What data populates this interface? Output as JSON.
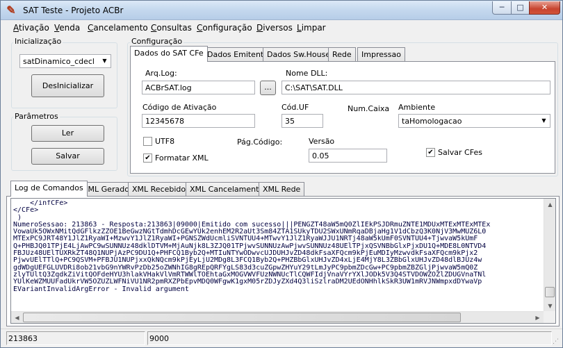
{
  "window": {
    "title": "SAT Teste - Projeto ACBr",
    "minimize": "─",
    "maximize": "□",
    "close": "✕",
    "icon": "acbr-app-icon"
  },
  "menu": [
    "Ativação",
    "Venda",
    "Cancelamento",
    "Consultas",
    "Configuração",
    "Diversos",
    "Limpar"
  ],
  "left": {
    "inicializacao": {
      "title": "Inicialização",
      "model": "satDinamico_cdecl",
      "button": "DesInicializar"
    },
    "parametros": {
      "title": "Parâmetros",
      "ler": "Ler",
      "salvar": "Salvar"
    }
  },
  "config": {
    "title": "Configuração",
    "tabs": [
      "Dados do SAT CFe",
      "Dados Emitente",
      "Dados Sw.House",
      "Rede",
      "Impressao"
    ],
    "arq_log": {
      "label": "Arq.Log:",
      "value": "ACBrSAT.log",
      "browse": "..."
    },
    "nome_dll": {
      "label": "Nome DLL:",
      "value": "C:\\SAT\\SAT.DLL"
    },
    "codigo_ativacao": {
      "label": "Código de Ativação",
      "value": "12345678"
    },
    "cod_uf": {
      "label": "Cód.UF",
      "value": "35"
    },
    "num_caixa": {
      "label": "Num.Caixa"
    },
    "ambiente": {
      "label": "Ambiente",
      "value": "taHomologacao"
    },
    "utf8": {
      "label": "UTF8",
      "checked": false
    },
    "formatar_xml": {
      "label": "Formatar XML",
      "checked": true
    },
    "pag_codigo": {
      "label": "Pág.Código:"
    },
    "versao": {
      "label": "Versão",
      "value": "0.05"
    },
    "salvar_cfes": {
      "label": "Salvar CFes",
      "checked": true
    }
  },
  "bottom_tabs": [
    "Log de Comandos",
    "XML Gerado",
    "XML Recebido",
    "XML Cancelamento",
    "XML Rede"
  ],
  "log_lines": [
    "    </infCFe>",
    "</CFe>",
    " )",
    "NumeroSessao: 213863 - Resposta:213863|09000|Emitido com sucesso|||PENGZT48aW5mQ0ZlIEkPSJDRmuZNTE1MDUxMTExMTExMTEx",
    "VowaUk5OWxNMitQdGFlkzZZOE1BeGwzNGtTdmhDcGEwYUk2enhEM2R2aUt3Sm84ZTA1SUkyTDU2SWxUNmRqaDBjaHg1V1dCbzQ3K0NjV3MwMUZ6L0",
    "MTExPC9JRT48Y1JlZ1RyaWI+MzwvY1JlZ1RyaWI+PGNSZWdUcmliSVNTUU4+MTwvY1JlZ1RyaWJJU1NRTj48aW5kUmF0SVNTUU4+TjwvaW5kUmF",
    "Q+PHBJQ01TPjE4LjAwPC9wSUNNUz48dklDTVM+MjAuNjk8L3ZJQ01TPjwvSUNNUzAwPjwvSUNNUz48UElTPjxQSVNBbGlxPjxDU1Q+MDE8L0NTVD4",
    "FBJUz48UElTUXRkZT48Q1NUPjAzPC9DU1Q+PHFCQ1Byb2Q+MTIuNTYwODwvcUJDUHJvZD48dkFsaXFQcm9kPjEuMDIyMzwvdkFsaXFQcm9kPjx2",
    "PjwvUElTTlQ+PC9QSVM+PFBJU1NUPjxxQkNQcm9kPjEyLjU2MDg8L3FCQ1Byb2Q+PHZBbGlxUHJvZD4xLjE4MjY8L3ZBbGlxUHJvZD48dlBJUz4w",
    "gdWDgUEFGLUVDRi8ob21vbG9nYWRvPzDb25oZWNhIG8gREpQRFYgLS83d3cuZGpwZHYuY29tLmJyPC9pbmZDcGw+PC9pbmZBZGljPjwvaW5mQ0Z",
    "zlyTUltQ3ZqdkZiVitQOFdeHYU3hlakVHakVlVmRTWWlTOEhtaGxMOGVWVFUzNWNUcTlCQWFIdjVnaVYrYXlJODk5V3Q4STVDOWZOZlZDUGVnaTNl",
    "YUlKeWZMUUFadUkrVW5OZUZLWFNiVU1NR2pmRXZPbEpvMDQ0WFgwK1gxM05rZDJyZXd4Q3liSzlraDM2UEdONHhlkSkR3UW1mRVJNWmpxdDYwaVp",
    "EVariantInvalidArgError - Invalid argument"
  ],
  "status": {
    "panel1": "213863",
    "panel2": "9000"
  }
}
